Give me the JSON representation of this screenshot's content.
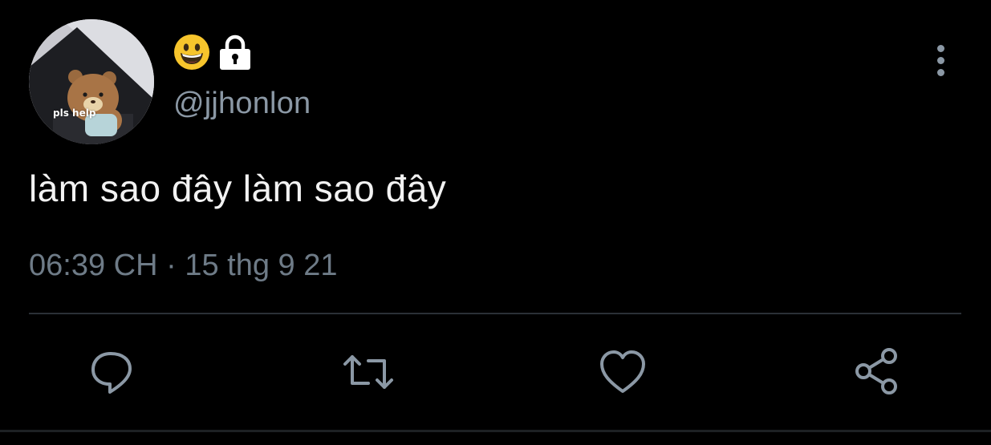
{
  "tweet": {
    "avatar_caption": "pls help",
    "display_name_icons": [
      "grinning-face-emoji",
      "lock-icon"
    ],
    "handle": "@jjhonlon",
    "text": "làm sao đây làm sao đây",
    "time": "06:39 CH",
    "separator": "·",
    "date": "15 thg 9 21"
  },
  "actions": [
    "reply-icon",
    "retweet-icon",
    "like-icon",
    "share-icon"
  ],
  "colors": {
    "background": "#000000",
    "text": "#f2f2f2",
    "muted": "#8b98a5",
    "divider": "#2b3036"
  }
}
